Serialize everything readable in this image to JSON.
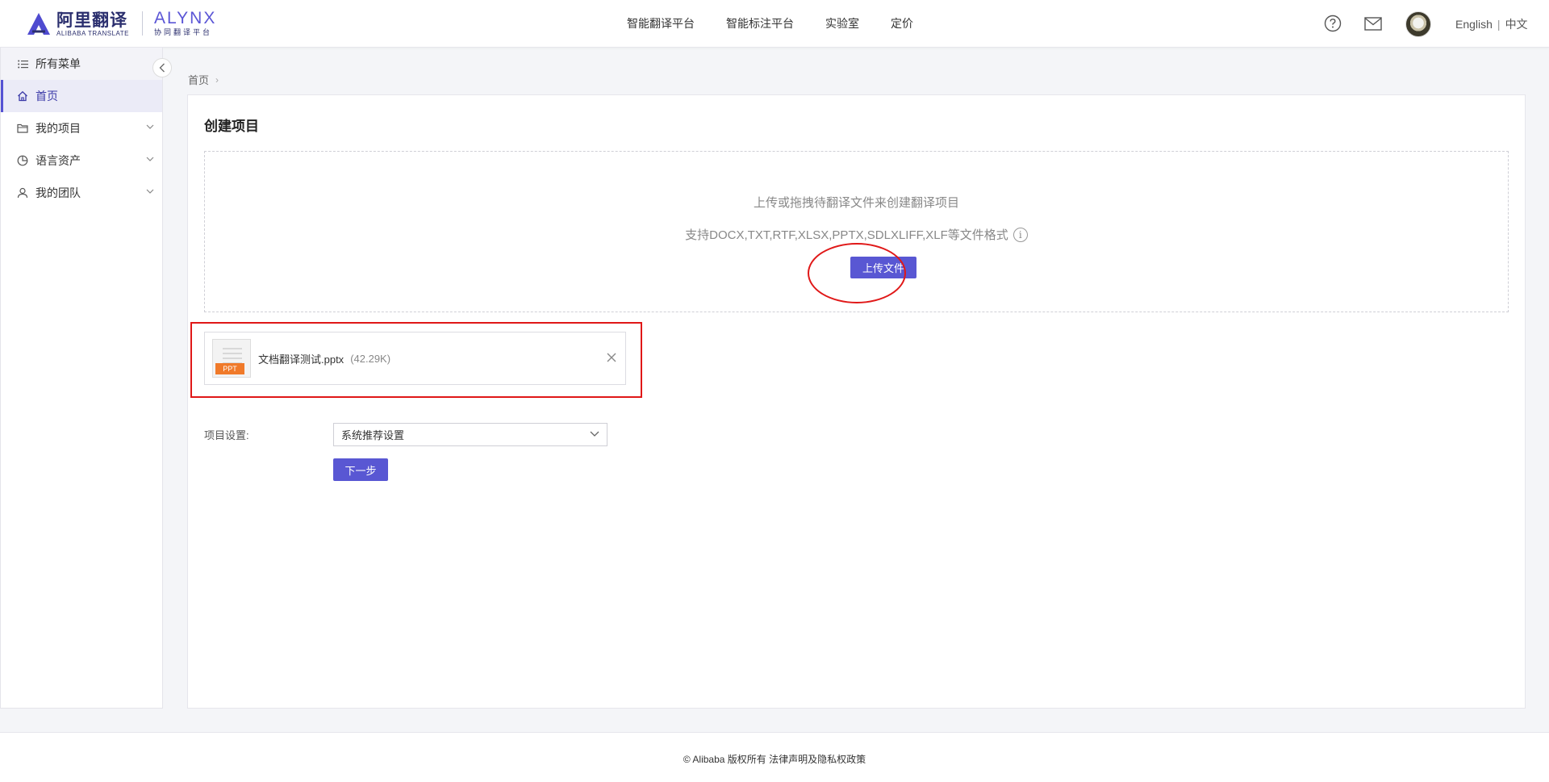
{
  "brand": {
    "cn_name": "阿里翻译",
    "cn_sub": "ALIBABA TRANSLATE",
    "en_name": "ALYNX",
    "en_sub": "协同翻译平台"
  },
  "nav": [
    {
      "label": "智能翻译平台"
    },
    {
      "label": "智能标注平台"
    },
    {
      "label": "实验室"
    },
    {
      "label": "定价"
    }
  ],
  "header": {
    "lang_en": "English",
    "lang_sep": "|",
    "lang_cn": "中文"
  },
  "sidebar": {
    "items": [
      {
        "label": "所有菜单",
        "icon": "list-icon"
      },
      {
        "label": "首页",
        "icon": "home-icon"
      },
      {
        "label": "我的项目",
        "icon": "folder-icon"
      },
      {
        "label": "语言资产",
        "icon": "pie-icon"
      },
      {
        "label": "我的团队",
        "icon": "user-icon"
      }
    ]
  },
  "breadcrumb": {
    "home": "首页",
    "arrow": "›"
  },
  "main": {
    "title": "创建项目",
    "dropzone": {
      "line1": "上传或拖拽待翻译文件来创建翻译项目",
      "line2": "支持DOCX,TXT,RTF,XLSX,PPTX,SDLXLIFF,XLF等文件格式",
      "info": "i",
      "upload_label": "上传文件"
    },
    "file": {
      "tag": "PPT",
      "name": "文档翻译测试.pptx",
      "size": "(42.29K)"
    },
    "settings": {
      "label": "项目设置:",
      "selected": "系统推荐设置",
      "next_label": "下一步"
    }
  },
  "footer": {
    "text": "© Alibaba 版权所有 法律声明及隐私权政策"
  },
  "colors": {
    "accent": "#5957d3",
    "annotation": "#e01818",
    "brand_dark": "#2b2f6e"
  }
}
